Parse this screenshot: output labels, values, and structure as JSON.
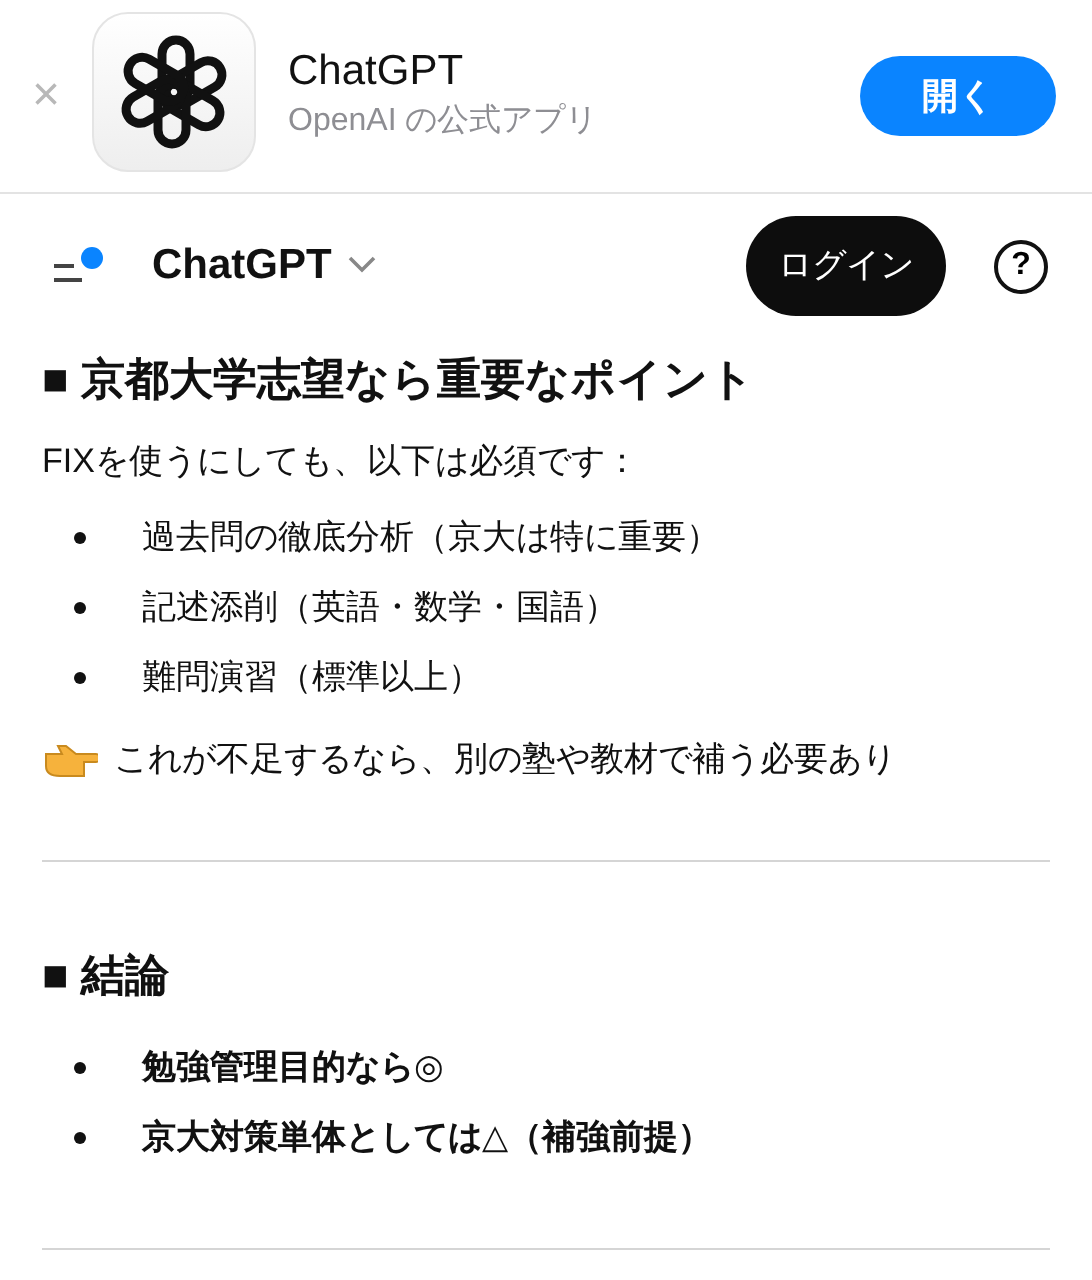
{
  "app_banner": {
    "close": "×",
    "app_name": "ChatGPT",
    "subtitle": "OpenAI の公式アプリ",
    "open_button": "開く"
  },
  "header": {
    "title": "ChatGPT",
    "login_button": "ログイン",
    "help": "?"
  },
  "sections": [
    {
      "heading": "■ 京都大学志望なら重要なポイント",
      "blocks": [
        {
          "kind": "paragraph",
          "text": "FIXを使うにしても、以下は必須です："
        },
        {
          "kind": "bullets",
          "bold": false,
          "items": [
            "過去問の徹底分析（京大は特に重要）",
            "記述添削（英語・数学・国語）",
            "難問演習（標準以上）"
          ]
        },
        {
          "kind": "note",
          "text": "これが不足するなら、別の塾や教材で補う必要あり"
        }
      ]
    },
    {
      "heading": "■ 結論",
      "blocks": [
        {
          "kind": "bullets",
          "bold": true,
          "items": [
            "勉強管理目的なら◎",
            "京大対策単体としては△（補強前提）"
          ]
        }
      ]
    }
  ]
}
